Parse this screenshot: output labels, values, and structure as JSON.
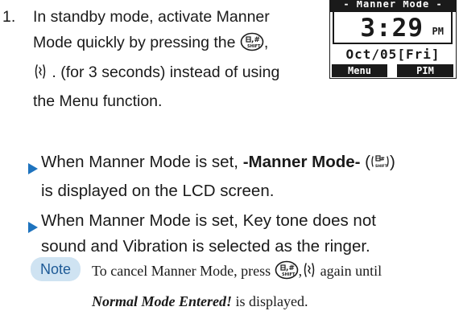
{
  "step": {
    "number": "1.",
    "line1": "In standby mode, activate Manner",
    "line2_prefix": "Mode quickly by pressing the",
    "line2_suffix": ",",
    "line3_suffix": ". (for 3 seconds) instead of using",
    "line4": "the Menu function."
  },
  "lcd": {
    "header": "- Manner Mode -",
    "time": "3:29",
    "ampm": "PM",
    "date": "Oct/05[Fri]",
    "soft_left": "Menu",
    "soft_right": "PIM"
  },
  "bullets": [
    {
      "line1_prefix": "When Manner Mode is set,",
      "line1_strong": "-Manner Mode-",
      "line1_suffix": ")",
      "line2": "is displayed on the LCD screen."
    },
    {
      "line1": "When Manner Mode is set, Key tone does not",
      "line2": "sound and Vibration is selected as the ringer."
    }
  ],
  "note": {
    "badge": "Note",
    "line1_prefix": "To cancel Manner Mode, press",
    "line1_mid": ",",
    "line1_suffix": "again until",
    "line2_em": "Normal Mode Entered!",
    "line2_suffix": "is displayed."
  },
  "colors": {
    "bullet_triangle": "#1e73be",
    "note_badge_bg": "#cfe3f2",
    "note_badge_text": "#1e5a96"
  }
}
